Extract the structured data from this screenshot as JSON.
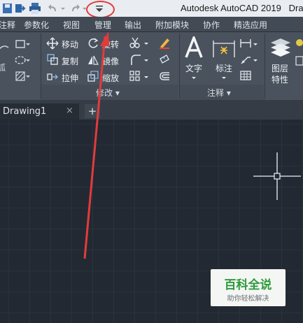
{
  "app": {
    "title": "Autodesk AutoCAD 2019",
    "title_suffix": "Dra"
  },
  "quick_access": {
    "icons": [
      "save-icon",
      "export-icon",
      "print-icon",
      "undo-icon",
      "redo-icon",
      "customize-dropdown-icon"
    ]
  },
  "ribbon_tabs": [
    {
      "label": "注释"
    },
    {
      "label": "参数化"
    },
    {
      "label": "视图"
    },
    {
      "label": "管理"
    },
    {
      "label": "输出"
    },
    {
      "label": "附加模块"
    },
    {
      "label": "协作"
    },
    {
      "label": "精选应用"
    }
  ],
  "panels": {
    "modify": {
      "title": "修改",
      "commands": {
        "move": "移动",
        "rotate": "旋转",
        "copy": "复制",
        "mirror": "镜像",
        "stretch": "拉伸",
        "scale": "缩放"
      }
    },
    "annotation": {
      "title": "注释",
      "text": "文字",
      "dimension": "标注"
    },
    "layers": {
      "label_line1": "图层",
      "label_line2": "特性"
    }
  },
  "document": {
    "tab_label": "Drawing1",
    "close_glyph": "×",
    "new_tab_glyph": "+"
  },
  "watermark": {
    "title": "百科全说",
    "subtitle": "助你轻松解决"
  },
  "colors": {
    "highlight": "#e33b3b",
    "watermark_green": "#2e9a3c"
  }
}
